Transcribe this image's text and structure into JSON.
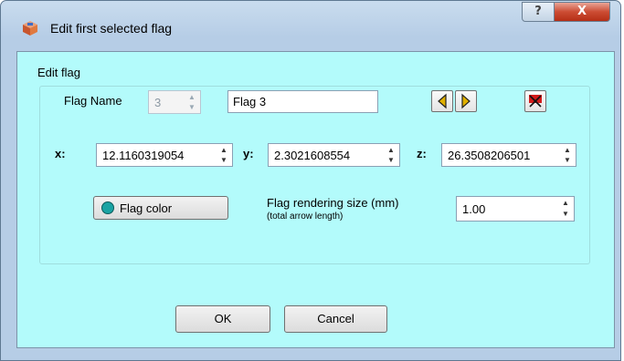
{
  "window": {
    "title": "Edit first selected flag",
    "help_glyph": "?",
    "close_glyph": "X"
  },
  "group": {
    "title": "Edit flag"
  },
  "flag_name": {
    "label": "Flag Name",
    "index": "3",
    "name": "Flag 3"
  },
  "coords": {
    "x_label": "x:",
    "x_value": "12.1160319054",
    "y_label": "y:",
    "y_value": "2.3021608554",
    "z_label": "z:",
    "z_value": "26.3508206501"
  },
  "color_button": {
    "label": "Flag color",
    "color": "#1aa3a3"
  },
  "render_size": {
    "label": "Flag rendering size (mm)",
    "sublabel": "(total arrow length)",
    "value": "1.00"
  },
  "footer": {
    "ok_label": "OK",
    "cancel_label": "Cancel"
  },
  "colors": {
    "background": "#b3fbfb",
    "nav_arrow": "#e0b000"
  },
  "icons": [
    "app-icon",
    "help-icon",
    "close-icon",
    "previous-flag-icon",
    "next-flag-icon",
    "delete-flag-icon",
    "spin-up-icon",
    "spin-down-icon"
  ]
}
